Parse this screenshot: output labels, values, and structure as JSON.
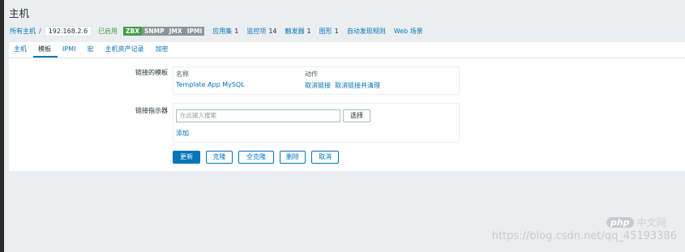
{
  "page": {
    "title": "主机"
  },
  "breadcrumb": {
    "all_hosts": "所有主机",
    "separator": "/",
    "current_host": "192.168.2.6",
    "status": "已启用",
    "availability": [
      "ZBX",
      "SNMP",
      "JMX",
      "IPMI"
    ],
    "nav": [
      {
        "label": "应用集",
        "count": "1"
      },
      {
        "label": "监控项",
        "count": "14"
      },
      {
        "label": "触发器",
        "count": "1"
      },
      {
        "label": "图形",
        "count": "1"
      },
      {
        "label": "自动发现规则",
        "count": ""
      },
      {
        "label": "Web 场景",
        "count": ""
      }
    ]
  },
  "tabs": [
    "主机",
    "模板",
    "IPMI",
    "宏",
    "主机资产记录",
    "加密"
  ],
  "active_tab": "模板",
  "form": {
    "linked_templates_label": "链接的模板",
    "col_name": "名称",
    "col_action": "动作",
    "template_name": "Template App MySQL",
    "unlink": "取消链接",
    "unlink_clear": "取消链接并清理",
    "link_indicator_label": "链接指示器",
    "search_placeholder": "在此输入搜索",
    "select_button": "选择",
    "add_link": "添加"
  },
  "buttons": {
    "update": "更新",
    "clone": "克隆",
    "full_clone": "全克隆",
    "delete": "删除",
    "cancel": "取消"
  },
  "watermark": {
    "logo": "php",
    "site": "中文网",
    "url": "https://blog.csdn.net/qq_45193386"
  },
  "colors": {
    "link": "#0275b8",
    "enabled": "#429e47",
    "zbx": "#429e47",
    "unavailable": "#8a9499"
  }
}
